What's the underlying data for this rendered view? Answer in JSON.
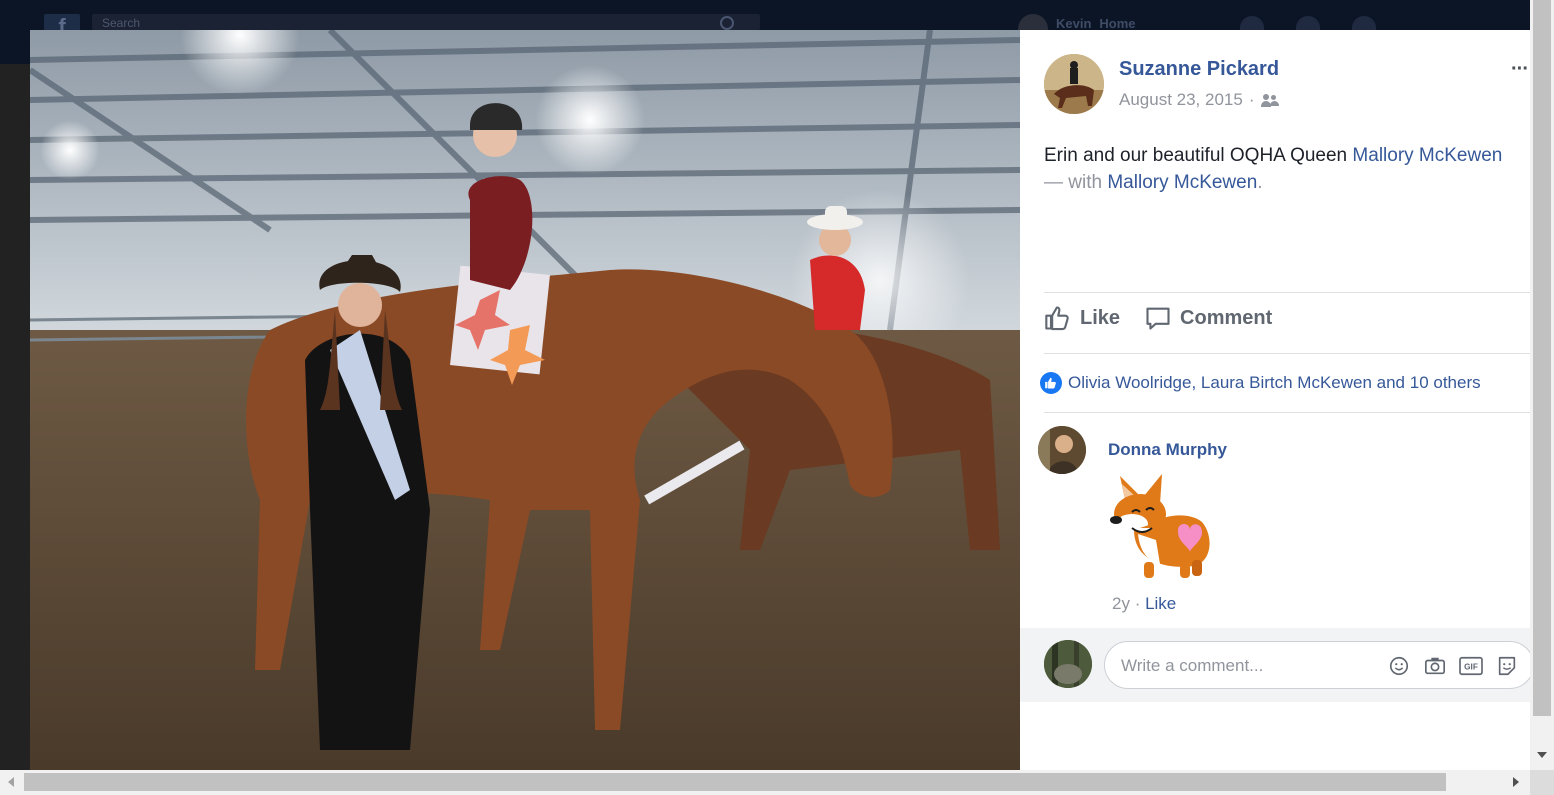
{
  "background": {
    "search_placeholder": "Search",
    "user_name": "Kevin",
    "home_label": "Home"
  },
  "post": {
    "author": "Suzanne Pickard",
    "date": "August 23, 2015",
    "date_separator": "·",
    "audience_icon": "friends-icon",
    "more_label": "···",
    "text_before": "Erin and our beautiful OQHA Queen ",
    "tag_1": "Mallory McKewen",
    "text_with": " — with ",
    "tag_2": "Mallory McKewen",
    "text_end": "."
  },
  "actions": {
    "like_label": "Like",
    "comment_label": "Comment"
  },
  "reactions": {
    "summary": "Olivia Woolridge, Laura Birtch McKewen and 10 others"
  },
  "comment": {
    "author": "Donna Murphy",
    "sticker": "corgi-heart-sticker",
    "age": "2y",
    "separator": " · ",
    "like_label": "Like"
  },
  "composer": {
    "placeholder": "Write a comment...",
    "icons": [
      "emoji-icon",
      "camera-icon",
      "gif-icon",
      "sticker-icon"
    ]
  },
  "colors": {
    "link": "#365899",
    "meta": "#90949c",
    "text": "#1d2129",
    "like_blue": "#1877f2"
  }
}
